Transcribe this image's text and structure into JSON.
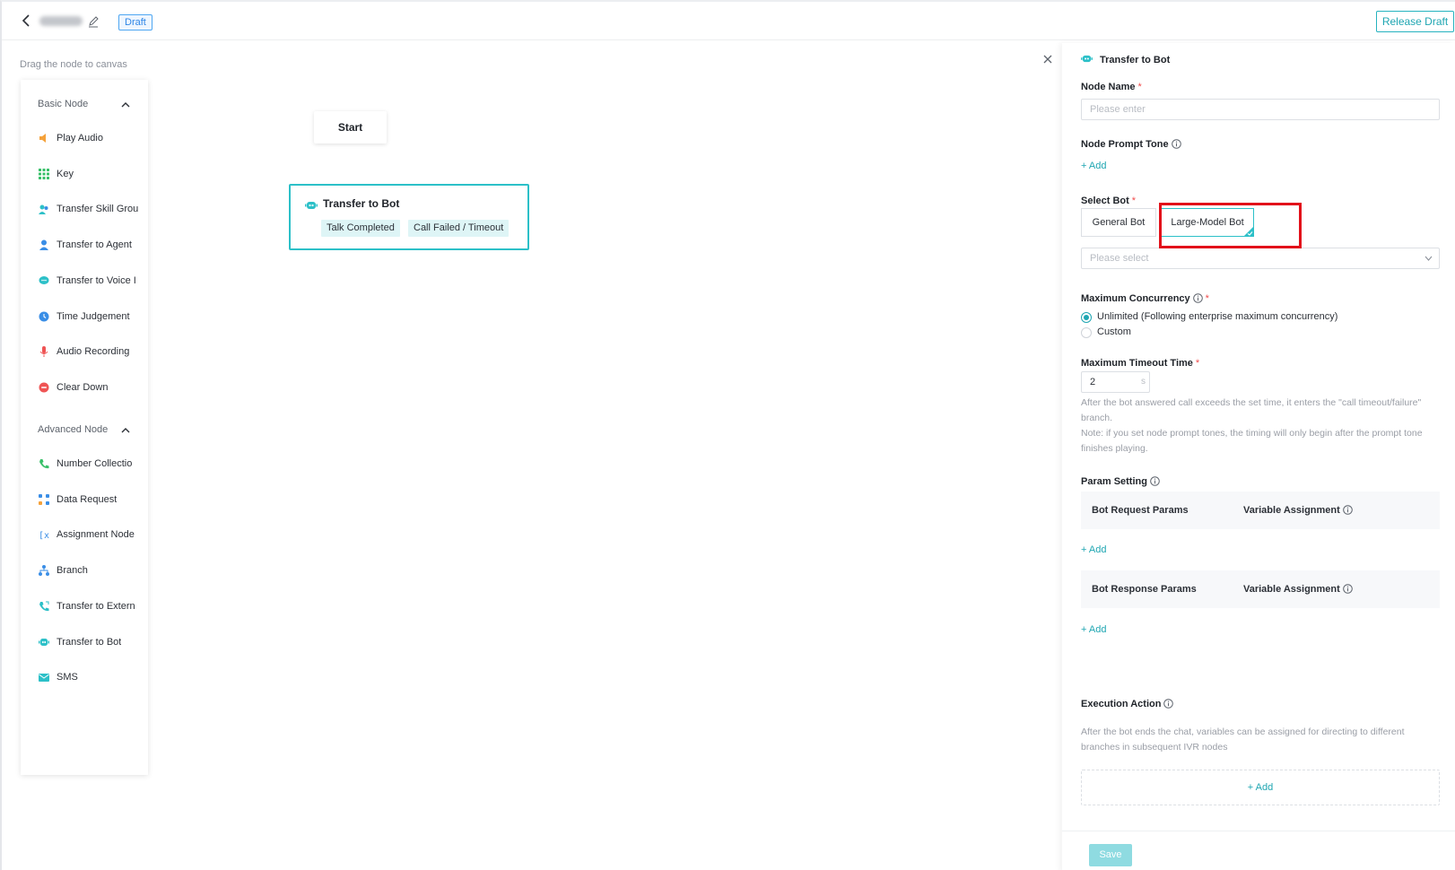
{
  "header": {
    "draft_badge": "Draft",
    "release_button": "Release Draft"
  },
  "palette": {
    "hint": "Drag the node to canvas",
    "basic_group": "Basic Node",
    "basic_items": [
      {
        "label": "Play Audio",
        "icon": "speaker-icon",
        "color": "#f5a23b"
      },
      {
        "label": "Key",
        "icon": "keypad-icon",
        "color": "#39c06a"
      },
      {
        "label": "Transfer Skill Grou",
        "icon": "skill-group-icon",
        "color": "#2cc0c8"
      },
      {
        "label": "Transfer to Agent",
        "icon": "agent-icon",
        "color": "#3a8ee6"
      },
      {
        "label": "Transfer to Voice I",
        "icon": "voice-bubble-icon",
        "color": "#2cc0c8"
      },
      {
        "label": "Time Judgement",
        "icon": "clock-icon",
        "color": "#3a8ee6"
      },
      {
        "label": "Audio Recording",
        "icon": "microphone-icon",
        "color": "#ef5454"
      },
      {
        "label": "Clear Down",
        "icon": "hangup-icon",
        "color": "#ef5454"
      }
    ],
    "advanced_group": "Advanced Node",
    "advanced_items": [
      {
        "label": "Number Collectio",
        "icon": "phone-collect-icon",
        "color": "#39c06a"
      },
      {
        "label": "Data Request",
        "icon": "data-request-icon",
        "color": "#3a8ee6"
      },
      {
        "label": "Assignment Node",
        "icon": "variable-icon",
        "color": "#3a8ee6"
      },
      {
        "label": "Branch",
        "icon": "branch-icon",
        "color": "#3a8ee6"
      },
      {
        "label": "Transfer to Extern",
        "icon": "phone-transfer-icon",
        "color": "#2cc0c8"
      },
      {
        "label": "Transfer to Bot",
        "icon": "bot-icon",
        "color": "#2cc0c8"
      },
      {
        "label": "SMS",
        "icon": "sms-icon",
        "color": "#2cc0c8"
      }
    ]
  },
  "canvas": {
    "start_label": "Start",
    "bot_node": {
      "title": "Transfer to Bot",
      "ports": [
        "Talk Completed",
        "Call Failed / Timeout"
      ]
    }
  },
  "panel": {
    "title": "Transfer to Bot",
    "node_name_label": "Node Name",
    "node_name_placeholder": "Please enter",
    "prompt_tone_label": "Node Prompt Tone",
    "add_label": "Add",
    "select_bot_label": "Select Bot",
    "bot_options": [
      "General Bot",
      "Large-Model Bot"
    ],
    "selected_bot": "Large-Model Bot",
    "bot_select_placeholder": "Please select",
    "max_concurrency_label": "Maximum Concurrency",
    "concurrency_options": [
      "Unlimited (Following enterprise maximum concurrency)",
      "Custom"
    ],
    "concurrency_selected": "Unlimited (Following enterprise maximum concurrency)",
    "max_timeout_label": "Maximum Timeout Time",
    "timeout_value": "2",
    "timeout_unit": "s",
    "timeout_help_1": "After the bot answered call exceeds the set time, it enters the \"call timeout/failure\" branch.",
    "timeout_help_2": "Note: if you set node prompt tones, the timing will only begin after the prompt tone finishes playing.",
    "param_setting_label": "Param Setting",
    "request_params_header": "Bot Request Params",
    "response_params_header": "Bot Response Params",
    "variable_assignment_header": "Variable Assignment",
    "execution_action_label": "Execution Action",
    "execution_help": "After the bot ends the chat, variables can be assigned for directing to different branches in subsequent IVR nodes",
    "save_button": "Save"
  },
  "colors": {
    "accent": "#1fa6b2",
    "node_border": "#2cc0c8",
    "highlight": "#e2101a",
    "required": "#f04b4b"
  }
}
